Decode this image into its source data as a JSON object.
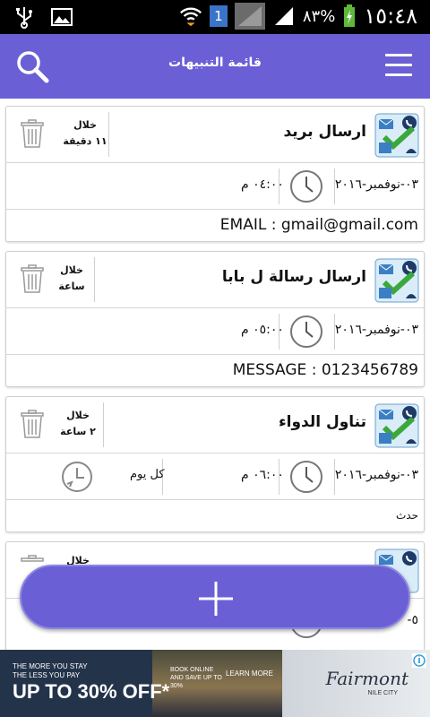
{
  "status_bar": {
    "battery": "٨٣%",
    "clock": "١٥:٤٨",
    "notification_badge": "1",
    "icons": [
      "usb-icon",
      "image-icon",
      "wifi-icon",
      "signal-icon",
      "mute-icon",
      "battery-charging-icon"
    ]
  },
  "app_bar": {
    "title": "قائمة التنبيهات",
    "background": "#6a5fd5",
    "search_icon": "search-icon",
    "menu_icon": "menu-icon"
  },
  "alerts": [
    {
      "title": "ارسال بريد",
      "remaining_line1": "خلال",
      "remaining_line2": "١١ دقيقة",
      "date": "٠٣-نوفمبر-٢٠١٦",
      "time": "٠٤:٠٠ م",
      "repeat": "",
      "detail": "EMAIL : gmail@gmail.com"
    },
    {
      "title": "ارسال رسالة ل بابا",
      "remaining_line1": "خلال",
      "remaining_line2": "ساعة",
      "date": "٠٣-نوفمبر-٢٠١٦",
      "time": "٠٥:٠٠ م",
      "repeat": "",
      "detail": "MESSAGE : 0123456789"
    },
    {
      "title": "تناول الدواء",
      "remaining_line1": "خلال",
      "remaining_line2": "٢ ساعة",
      "date": "٠٣-نوفمبر-٢٠١٦",
      "time": "٠٦:٠٠ م",
      "repeat": "كل يوم",
      "detail": "حدث"
    },
    {
      "remaining_line1": "خلال",
      "date_partial": "٥-"
    }
  ],
  "ad": {
    "line1": "THE MORE YOU STAY",
    "line2": "THE LESS YOU PAY",
    "offer": "UP TO 30% OFF*",
    "book_text": "BOOK ONLINE AND SAVE UP TO 30%",
    "learn_more": "LEARN MORE",
    "brand": "Fairmont",
    "brand_sub": "NILE CITY"
  }
}
